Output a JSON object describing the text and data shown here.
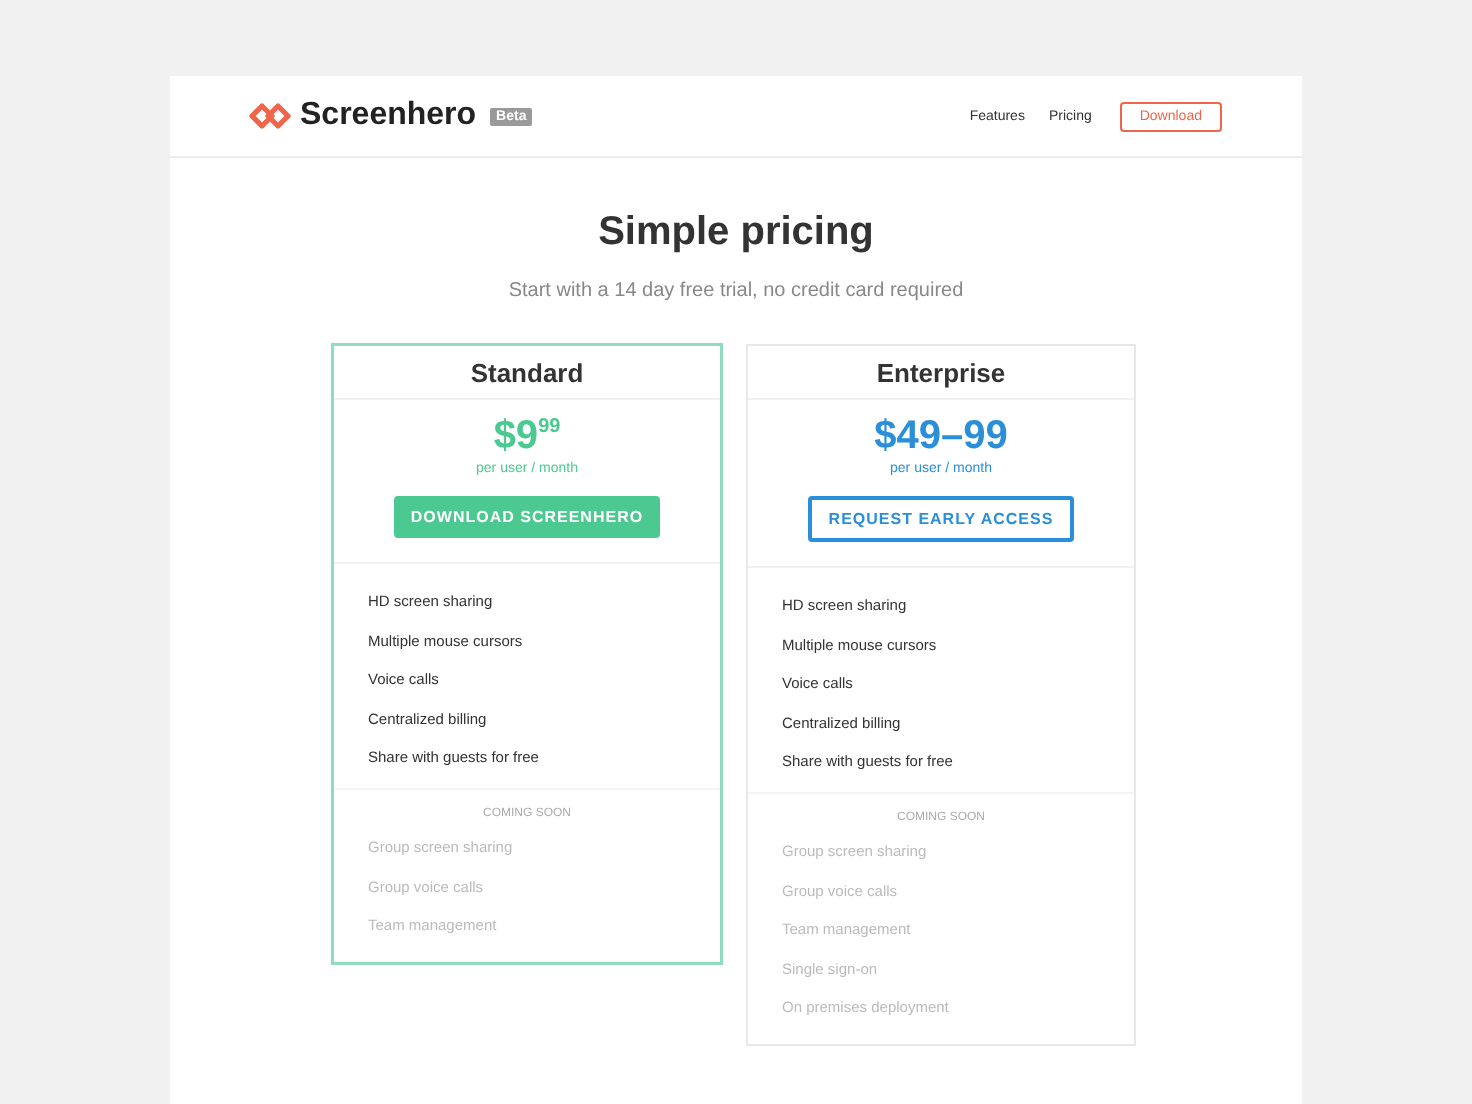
{
  "header": {
    "logo": "Screenhero",
    "badge": "Beta",
    "nav": [
      {
        "label": "Features",
        "kind": "link"
      },
      {
        "label": "Pricing",
        "kind": "link"
      },
      {
        "label": "Download",
        "kind": "button"
      }
    ]
  },
  "hero": {
    "title": "Simple pricing",
    "subtitle": "Start with a 14 day free trial, no credit card required"
  },
  "plans": [
    {
      "name": "Standard",
      "highlighted": true,
      "color": "#4cc991",
      "price": "$9$^{99}$",
      "period": "per user / month",
      "button": {
        "label": "DOWNLOAD SCREENHERO",
        "kind": "filled"
      },
      "features": [
        "HD screen sharing",
        "Multiple mouse cursors",
        "Voice calls",
        "Centralized billing",
        "Share with guests for free"
      ],
      "coming_label": "COMING SOON",
      "coming": [
        "Group screen sharing",
        "Group voice calls",
        "Team management"
      ]
    },
    {
      "name": "Enterprise",
      "highlighted": false,
      "color": "#2a8fd8",
      "price": "$49–99",
      "period": "per user / month",
      "button": {
        "label": "REQUEST EARLY ACCESS",
        "kind": "outline"
      },
      "features": [
        "HD screen sharing",
        "Multiple mouse cursors",
        "Voice calls",
        "Centralized billing",
        "Share with guests for free"
      ],
      "coming_label": "COMING SOON",
      "coming": [
        "Group screen sharing",
        "Group voice calls",
        "Team management",
        "Single sign-on",
        "On premises deployment"
      ]
    }
  ]
}
